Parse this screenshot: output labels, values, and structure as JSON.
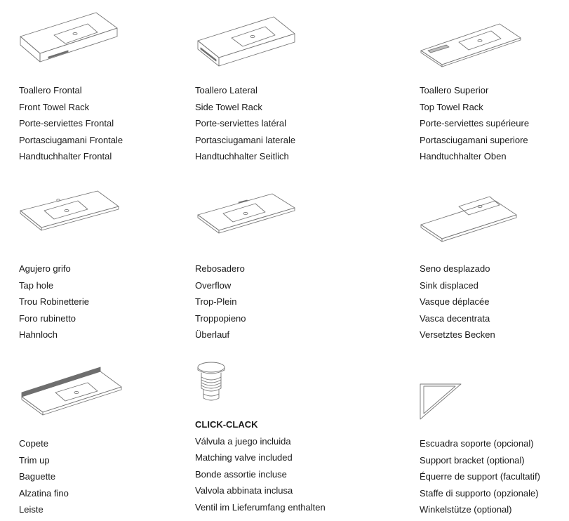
{
  "items": [
    {
      "id": "front-towel-rack",
      "icon": "front-towel-rack-sink-icon",
      "lines": [
        "Toallero Frontal",
        "Front Towel Rack",
        "Porte-serviettes Frontal",
        "Portasciugamani Frontale",
        "Handtuchhalter Frontal"
      ]
    },
    {
      "id": "side-towel-rack",
      "icon": "side-towel-rack-sink-icon",
      "lines": [
        "Toallero Lateral",
        "Side Towel Rack",
        "Porte-serviettes latéral",
        "Portasciugamani laterale",
        "Handtuchhalter Seitlich"
      ]
    },
    {
      "id": "top-towel-rack",
      "icon": "top-towel-rack-sink-icon",
      "lines": [
        "Toallero Superior",
        "Top Towel Rack",
        "Porte-serviettes supérieure",
        "Portasciugamani superiore",
        "Handtuchhalter Oben"
      ]
    },
    {
      "id": "tap-hole",
      "icon": "tap-hole-sink-icon",
      "lines": [
        "Agujero grifo",
        "Tap hole",
        "Trou Robinetterie",
        "Foro rubinetto",
        "Hahnloch"
      ]
    },
    {
      "id": "overflow",
      "icon": "overflow-sink-icon",
      "lines": [
        "Rebosadero",
        "Overflow",
        "Trop-Plein",
        "Troppopieno",
        "Überlauf"
      ]
    },
    {
      "id": "sink-displaced",
      "icon": "displaced-sink-icon",
      "lines": [
        "Seno desplazado",
        "Sink displaced",
        "Vasque déplacée",
        "Vasca decentrata",
        "Versetztes Becken"
      ]
    },
    {
      "id": "trim-up",
      "icon": "trim-up-sink-icon",
      "lines": [
        "Copete",
        "Trim up",
        "Baguette",
        "Alzatina fino",
        "Leiste"
      ]
    },
    {
      "id": "click-clack",
      "icon": "click-clack-valve-icon",
      "brand": "CLICK-CLACK",
      "lines": [
        "Válvula a juego incluida",
        "Matching valve included",
        "Bonde assortie incluse",
        "Valvola abbinata inclusa",
        "Ventil im Lieferumfang enthalten"
      ]
    },
    {
      "id": "support-bracket",
      "icon": "support-bracket-icon",
      "lines": [
        "Escuadra soporte (opcional)",
        "Support bracket (optional)",
        "Équerre de support (facultatif)",
        "Staffe di supporto (opzionale)",
        "Winkelstütze (optional)"
      ]
    }
  ]
}
